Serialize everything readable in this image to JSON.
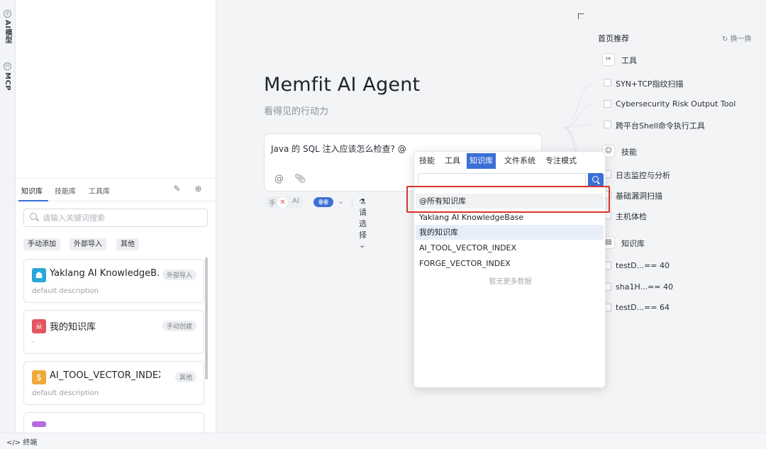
{
  "rail": {
    "items": [
      {
        "label": "AI模型",
        "icon": "gear-icon"
      },
      {
        "label": "MCP",
        "icon": "mcp-icon"
      }
    ]
  },
  "left_panel": {
    "tabs": [
      "知识库",
      "技能库",
      "工具库"
    ],
    "active_tab": "知识库",
    "search_placeholder": "请输入关键词搜索",
    "filters": [
      "手动添加",
      "外部导入",
      "其他"
    ],
    "cards": [
      {
        "title": "Yaklang AI KnowledgeB...",
        "badge": "外部导入",
        "desc": "default description",
        "avatar_color": "#2aa7d8"
      },
      {
        "title": "我的知识库",
        "badge": "手动创建",
        "desc": "-",
        "avatar_color": "#e35561"
      },
      {
        "title": "AI_TOOL_VECTOR_INDEX",
        "badge": "其他",
        "desc": "default description",
        "avatar_color": "#f0a93b"
      }
    ]
  },
  "main": {
    "title": "Memfit AI Agent",
    "subtitle": "看得见的行动力",
    "input_text": "Java 的 SQL 注入应该怎么检查? @",
    "toolbar": {
      "model_select": "请选择",
      "toggle_left": "手",
      "toggle_right": "AI",
      "pill": "ꙮꙮ"
    }
  },
  "popup": {
    "tabs": [
      "技能",
      "工具",
      "知识库",
      "文件系统",
      "专注模式"
    ],
    "active_tab": "知识库",
    "items": [
      "@所有知识库",
      "Yaklang AI KnowledgeBase",
      "我的知识库",
      "AI_TOOL_VECTOR_INDEX",
      "FORGE_VECTOR_INDEX"
    ],
    "empty_text": "暂无更多数据"
  },
  "recommend": {
    "title": "首页推荐",
    "refresh": "换一换",
    "groups": [
      {
        "name": "工具",
        "icon": "tools-icon",
        "items": [
          "SYN+TCP指纹扫描",
          "Cybersecurity Risk Output Tool",
          "跨平台Shell命令执行工具"
        ]
      },
      {
        "name": "技能",
        "icon": "robot-icon",
        "items": [
          "日志监控与分析",
          "基础漏洞扫描",
          "主机体检"
        ]
      },
      {
        "name": "知识库",
        "icon": "book-icon",
        "items": [
          "testD...== 40",
          "sha1H...== 40",
          "testD...== 64"
        ]
      }
    ]
  },
  "bottom": {
    "terminal": "终端"
  },
  "colors": {
    "accent": "#3b6fd6",
    "highlight_border": "#d9342b"
  }
}
